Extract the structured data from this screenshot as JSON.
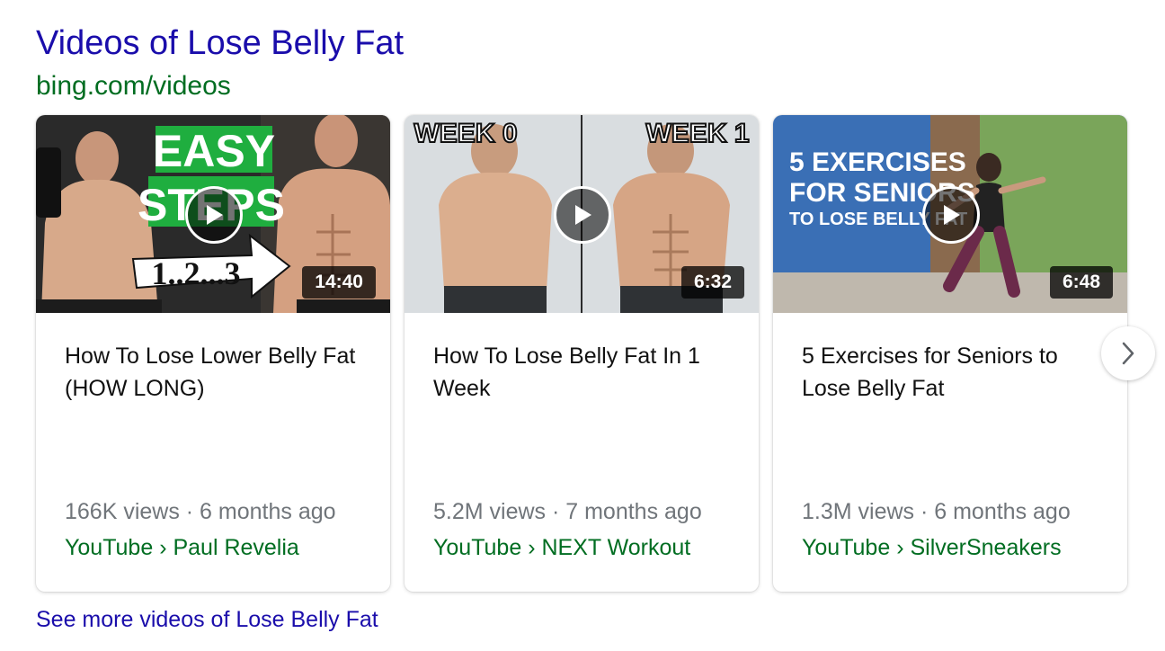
{
  "section": {
    "title": "Videos of Lose Belly Fat",
    "url": "bing.com/videos",
    "see_more": "See more videos of Lose Belly Fat"
  },
  "icons": {
    "play": "play-icon",
    "next": "chevron-right-icon"
  },
  "colors": {
    "title_link": "#1a0dab",
    "url_green": "#006d21",
    "meta_gray": "#70757a"
  },
  "videos": [
    {
      "title": "How To Lose Lower Belly Fat (HOW LONG)",
      "duration": "14:40",
      "views": "166K views",
      "age": "6 months ago",
      "meta": "166K views · 6 months ago",
      "source": "YouTube › Paul Revelia",
      "thumb_text": [
        "EASY",
        "STEPS",
        "1..2...3"
      ]
    },
    {
      "title": "How To Lose Belly Fat In 1 Week",
      "duration": "6:32",
      "views": "5.2M views",
      "age": "7 months ago",
      "meta": "5.2M views · 7 months ago",
      "source": "YouTube › NEXT Workout",
      "thumb_text": [
        "WEEK 0",
        "WEEK 1"
      ]
    },
    {
      "title": "5 Exercises for Seniors to Lose Belly Fat",
      "duration": "6:48",
      "views": "1.3M views",
      "age": "6 months ago",
      "meta": "1.3M views · 6 months ago",
      "source": "YouTube › SilverSneakers",
      "thumb_text": [
        "5 EXERCISES",
        "FOR SENIORS",
        "TO LOSE BELLY FAT"
      ]
    }
  ]
}
